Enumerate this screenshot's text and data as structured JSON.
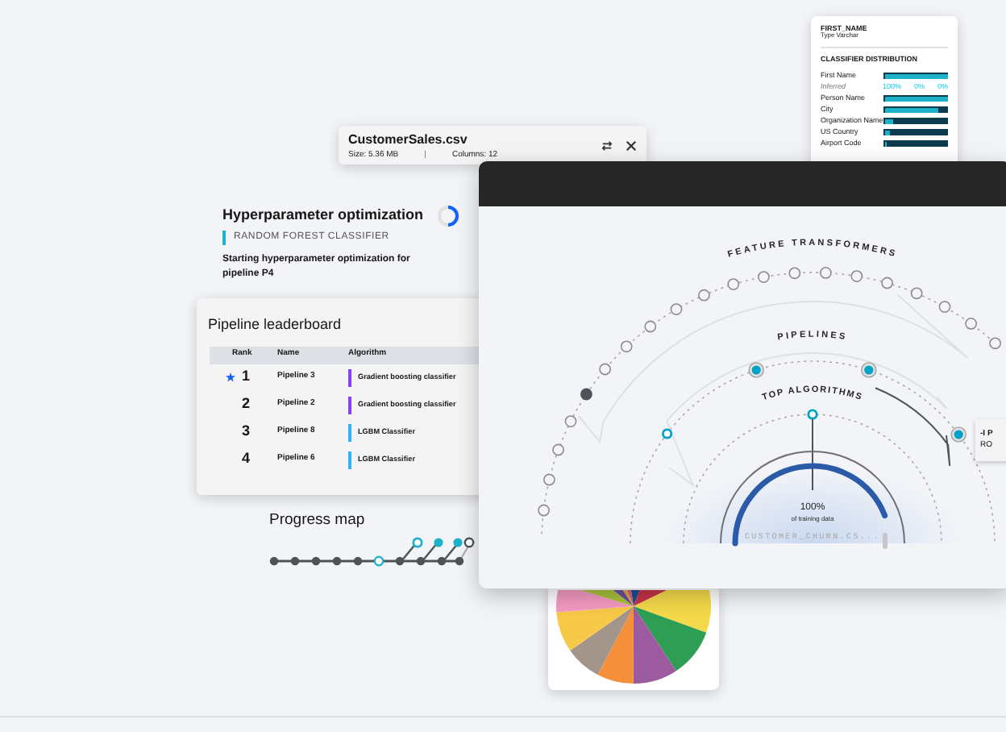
{
  "column_profile": {
    "name": "FIRST_NAME",
    "type": "Type Varchar",
    "section_title": "CLASSIFIER DISTRIBUTION",
    "rows": [
      {
        "kind": "bar",
        "label": "First Name",
        "level": 1
      },
      {
        "kind": "legend",
        "label": "Inferred",
        "values": [
          "100%",
          "0%",
          "0%"
        ]
      },
      {
        "kind": "bar",
        "label": "Person Name",
        "level": 1
      },
      {
        "kind": "bar",
        "label": "City",
        "level": 0.85
      },
      {
        "kind": "bar",
        "label": "Organization Name",
        "level": 0.15
      },
      {
        "kind": "bar",
        "label": "US Country",
        "level": 0.08
      },
      {
        "kind": "bar",
        "label": "Airport Code",
        "level": 0.05
      }
    ]
  },
  "dataset_card": {
    "title": "CustomerSales.csv",
    "size": "Size: 5.36 MB",
    "separator": "|",
    "columns": "Columns: 12"
  },
  "optimization": {
    "title": "Hyperparameter optimization",
    "classifier": "RANDOM FOREST CLASSIFIER",
    "message": "Starting hyperparameter optimization for pipeline P4"
  },
  "leaderboard": {
    "title": "Pipeline leaderboard",
    "columns": [
      "Rank",
      "Name",
      "Algorithm"
    ],
    "rows": [
      {
        "rank": "1",
        "starred": true,
        "name": "Pipeline 3",
        "algorithm": "Gradient boosting classifier",
        "color": "#8a3ffc"
      },
      {
        "rank": "2",
        "starred": false,
        "name": "Pipeline 2",
        "algorithm": "Gradient boosting classifier",
        "color": "#8a3ffc"
      },
      {
        "rank": "3",
        "starred": false,
        "name": "Pipeline 8",
        "algorithm": "LGBM Classifier",
        "color": "#33b1ff"
      },
      {
        "rank": "4",
        "starred": false,
        "name": "Pipeline 6",
        "algorithm": "LGBM Classifier",
        "color": "#33b1ff"
      }
    ]
  },
  "progress_map": {
    "title": "Progress map"
  },
  "diagram": {
    "outer_label": "FEATURE TRANSFORMERS",
    "middle_label": "PIPELINES",
    "inner_label": "TOP ALGORITHMS",
    "percent": "100%",
    "caption": "of training data",
    "dataset": "CUSTOMER_CHURN.CS...",
    "callout": [
      "-I P",
      "RO"
    ]
  }
}
